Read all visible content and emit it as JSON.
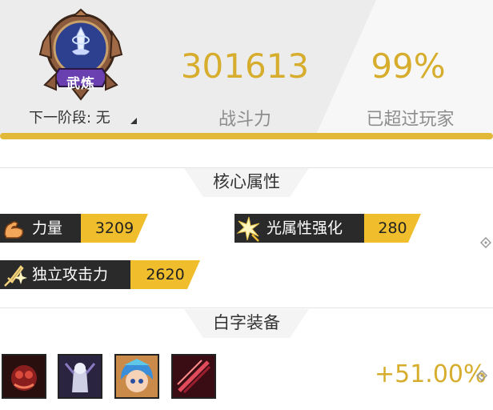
{
  "rank": {
    "badge_label": "武炼",
    "next_stage": "下一阶段: 无",
    "icon": "sword-shield-badge-icon"
  },
  "stats": {
    "power_value": "301613",
    "power_label": "战斗力",
    "exceed_value": "99%",
    "exceed_label": "已超过玩家"
  },
  "core": {
    "title": "核心属性",
    "items": [
      {
        "icon": "muscle-arm-icon",
        "name": "力量",
        "value": "3209"
      },
      {
        "icon": "light-burst-icon",
        "name": "光属性强化",
        "value": "280"
      },
      {
        "icon": "sword-spark-icon",
        "name": "独立攻击力",
        "value": "2620"
      }
    ]
  },
  "equipment": {
    "title": "白字装备",
    "bonus": "+51.00%",
    "items": [
      {
        "icon": "red-beast-item-icon"
      },
      {
        "icon": "pale-armor-item-icon"
      },
      {
        "icon": "blue-hair-girl-item-icon"
      },
      {
        "icon": "crimson-slash-item-icon"
      }
    ]
  },
  "colors": {
    "accent_gold": "#e2b838",
    "value_gold": "#d6ad2c",
    "tag_dark": "#2a2a2a",
    "tag_yellow": "#f0be2c"
  }
}
